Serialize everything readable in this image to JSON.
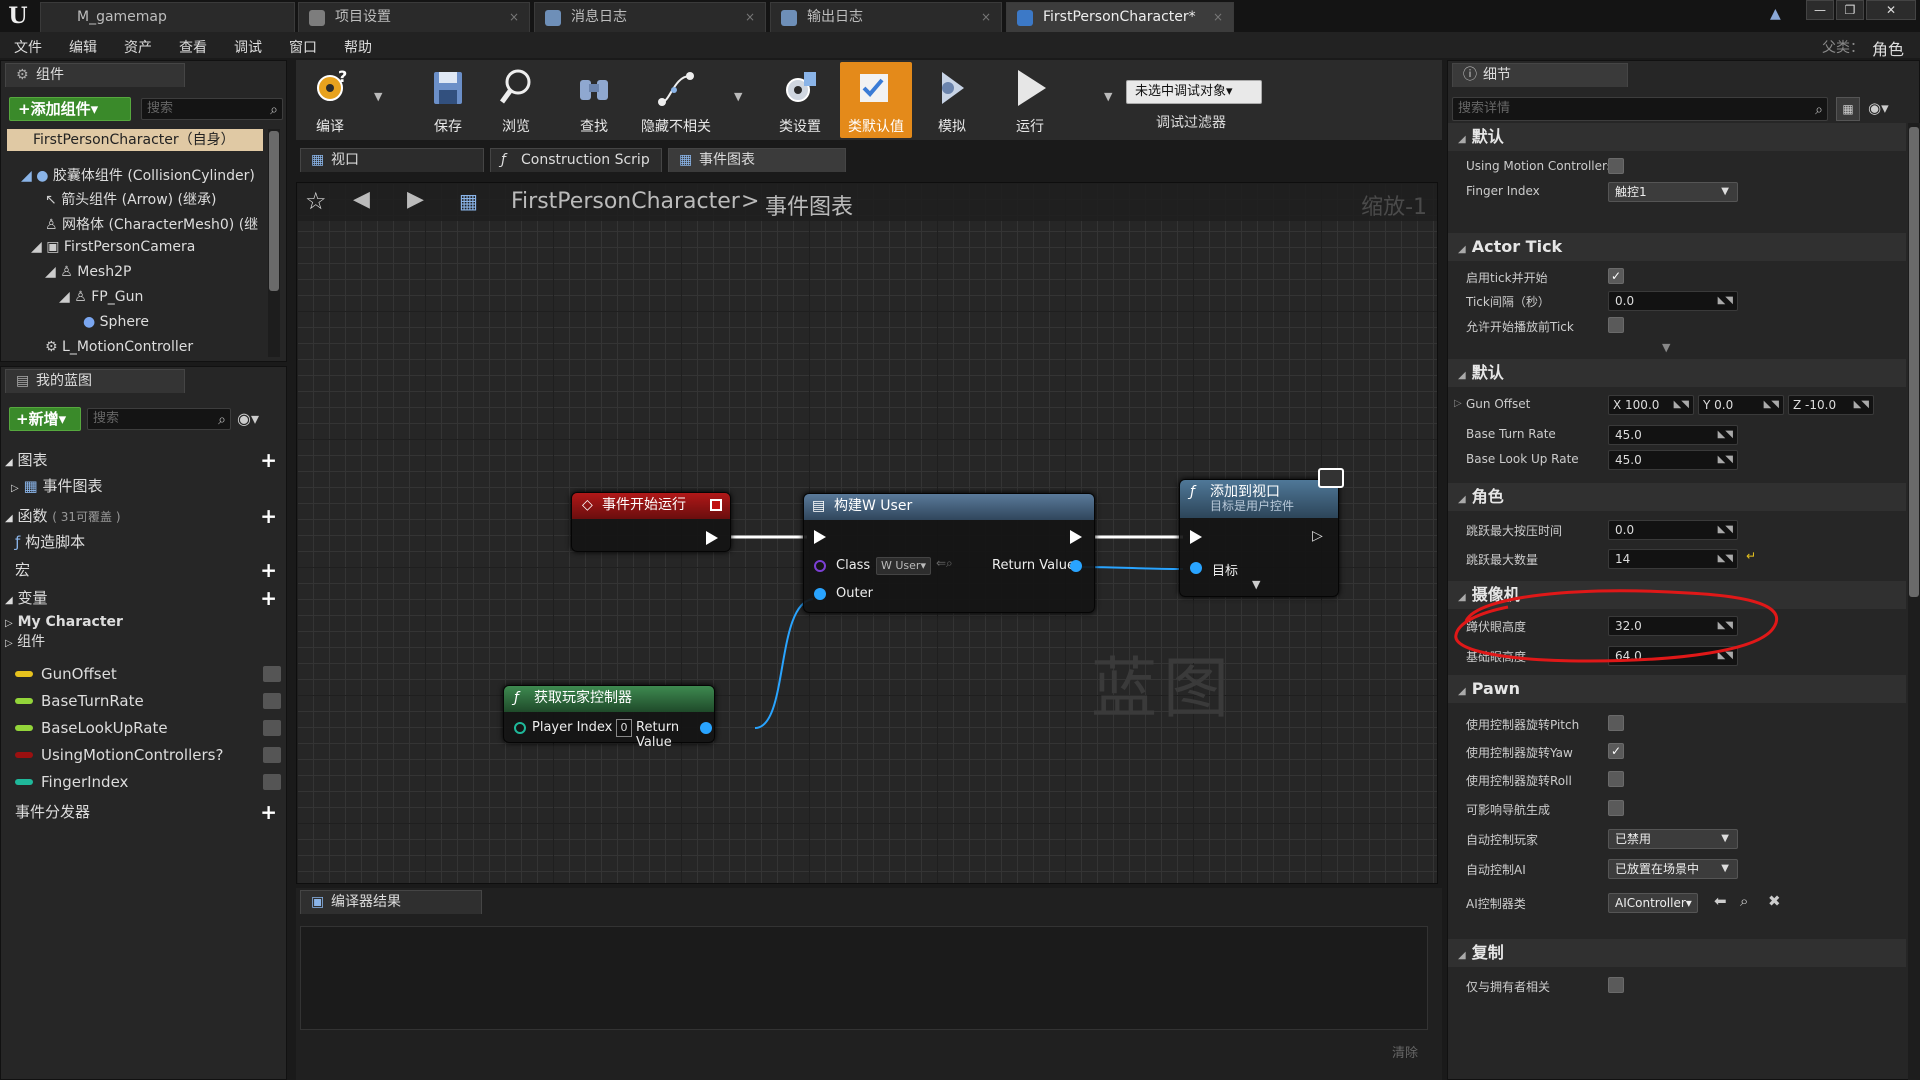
{
  "app": {
    "logo": "U"
  },
  "doc_tabs": [
    {
      "label": "M_gamemap"
    },
    {
      "label": "项目设置"
    },
    {
      "label": "消息日志"
    },
    {
      "label": "输出日志"
    },
    {
      "label": "FirstPersonCharacter*"
    }
  ],
  "window": {
    "parent_label": "父类：",
    "parent_value": "角色"
  },
  "menu": [
    "文件",
    "编辑",
    "资产",
    "查看",
    "调试",
    "窗口",
    "帮助"
  ],
  "components_panel": {
    "tab": "组件",
    "add_button": "+添加组件▾",
    "search_placeholder": "搜索",
    "root": "FirstPersonCharacter（自身）",
    "items": [
      "胶囊体组件 (CollisionCylinder)",
      "箭头组件 (Arrow) (继承)",
      "网格体 (CharacterMesh0) (继",
      "FirstPersonCamera",
      "Mesh2P",
      "FP_Gun",
      "Sphere",
      "L_MotionController"
    ]
  },
  "blueprint_panel": {
    "tab": "我的蓝图",
    "new_button": "+新增▾",
    "search_placeholder": "搜索",
    "sections": {
      "graphs": "图表",
      "event_graph": "事件图表",
      "functions": "函数",
      "functions_note": "( 31可覆盖 )",
      "construction": "构造脚本",
      "macros": "宏",
      "variables": "变量",
      "my_character": "My Character",
      "components": "组件",
      "dispatchers": "事件分发器"
    },
    "variables": [
      {
        "name": "GunOffset",
        "color": "#e6c21e"
      },
      {
        "name": "BaseTurnRate",
        "color": "#93d53a"
      },
      {
        "name": "BaseLookUpRate",
        "color": "#93d53a"
      },
      {
        "name": "UsingMotionControllers?",
        "color": "#9b1010"
      },
      {
        "name": "FingerIndex",
        "color": "#1fb89a"
      }
    ]
  },
  "toolbar": {
    "compile": "编译",
    "save": "保存",
    "browse": "浏览",
    "find": "查找",
    "hide": "隐藏不相关",
    "class_settings": "类设置",
    "class_defaults": "类默认值",
    "simulate": "模拟",
    "play": "运行",
    "debug_target": "未选中调试对象▾",
    "debug_filter": "调试过滤器"
  },
  "graph_tabs": {
    "viewport": "视口",
    "construction": "Construction Scrip",
    "event_graph": "事件图表"
  },
  "graph": {
    "breadcrumb_root": "FirstPersonCharacter",
    "breadcrumb_sep": ">",
    "breadcrumb_leaf": "事件图表",
    "zoom": "缩放-1",
    "watermark": "蓝图",
    "nodes": {
      "begin_play": {
        "title": "事件开始运行"
      },
      "create_widget": {
        "title": "构建W User",
        "class_label": "Class",
        "class_value": "W User▾",
        "outer": "Outer",
        "return_value": "Return Value"
      },
      "add_viewport": {
        "title": "添加到视口",
        "subtitle": "目标是用户控件",
        "target": "目标"
      },
      "get_player": {
        "title": "获取玩家控制器",
        "player_index": "Player Index",
        "player_index_value": "0",
        "return_value": "Return Value"
      }
    }
  },
  "compiler": {
    "tab": "编译器结果",
    "clear": "清除"
  },
  "details": {
    "tab": "细节",
    "search_placeholder": "搜索详情",
    "sections": [
      {
        "title": "默认",
        "props": [
          {
            "label": "Using Motion Controllers",
            "type": "check",
            "value": false
          },
          {
            "label": "Finger Index",
            "type": "dropdown",
            "value": "触控1"
          }
        ]
      },
      {
        "title": "Actor Tick",
        "props": [
          {
            "label": "启用tick并开始",
            "type": "check",
            "value": true
          },
          {
            "label": "Tick间隔（秒）",
            "type": "number",
            "value": "0.0"
          },
          {
            "label": "允许开始播放前Tick",
            "type": "check",
            "value": false
          }
        ]
      },
      {
        "title": "默认",
        "props": [
          {
            "label": "Gun Offset",
            "type": "vector",
            "x": "X  100.0",
            "y": "Y  0.0",
            "z": "Z  -10.0"
          },
          {
            "label": "Base Turn Rate",
            "type": "number",
            "value": "45.0"
          },
          {
            "label": "Base Look Up Rate",
            "type": "number",
            "value": "45.0"
          }
        ]
      },
      {
        "title": "角色",
        "props": [
          {
            "label": "跳跃最大按压时间",
            "type": "number",
            "value": "0.0"
          },
          {
            "label": "跳跃最大数量",
            "type": "number",
            "value": "14"
          }
        ]
      },
      {
        "title": "摄像机",
        "props": [
          {
            "label": "蹲伏眼高度",
            "type": "number",
            "value": "32.0"
          },
          {
            "label": "基础眼高度",
            "type": "number",
            "value": "64.0"
          }
        ]
      },
      {
        "title": "Pawn",
        "props": [
          {
            "label": "使用控制器旋转Pitch",
            "type": "check",
            "value": false
          },
          {
            "label": "使用控制器旋转Yaw",
            "type": "check",
            "value": true
          },
          {
            "label": "使用控制器旋转Roll",
            "type": "check",
            "value": false
          },
          {
            "label": "可影响导航生成",
            "type": "check",
            "value": false
          },
          {
            "label": "自动控制玩家",
            "type": "dropdown",
            "value": "已禁用"
          },
          {
            "label": "自动控制AI",
            "type": "dropdown",
            "value": "已放置在场景中"
          },
          {
            "label": "AI控制器类",
            "type": "class",
            "value": "AIController▾"
          }
        ]
      },
      {
        "title": "复制",
        "props": [
          {
            "label": "仅与拥有者相关",
            "type": "check",
            "value": false
          }
        ]
      }
    ]
  },
  "colors": {
    "accent": "#e48a1a",
    "annotation": "#e01818",
    "exec_wire": "#ffffff",
    "object_wire": "#29a4ff"
  }
}
